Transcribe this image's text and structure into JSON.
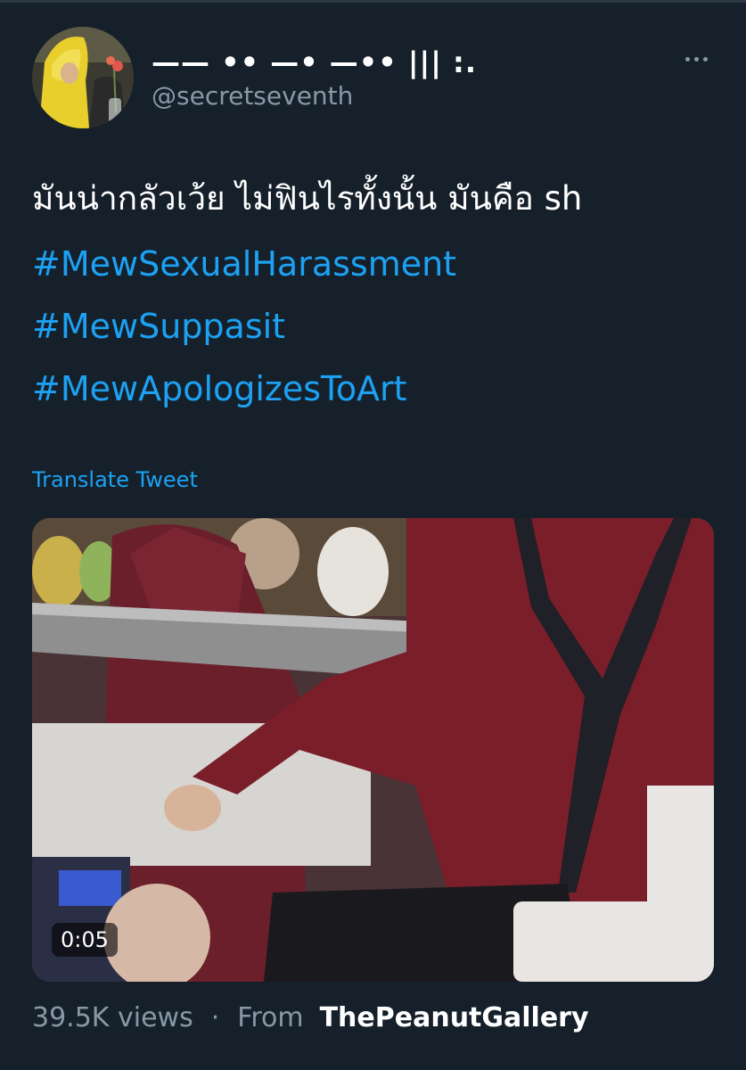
{
  "tweet": {
    "display_name": "—— •• —• —•• ||| :.",
    "handle": "@secretseventh",
    "more_icon": "more-dots-icon",
    "text": "มันน่ากลัวเว้ย ไม่ฟินไรทั้งนั้น มันคือ sh",
    "hashtags": [
      "#MewSexualHarassment",
      "#MewSuppasit",
      "#MewApologizesToArt"
    ],
    "translate_label": "Translate Tweet",
    "video": {
      "duration": "0:05"
    },
    "views": "39.5K views",
    "separator": "·",
    "from_label": "From",
    "source": "ThePeanutGallery"
  },
  "colors": {
    "background": "#15202b",
    "accent": "#1da1f2",
    "secondary_text": "#8899a6",
    "primary_text": "#ffffff"
  }
}
